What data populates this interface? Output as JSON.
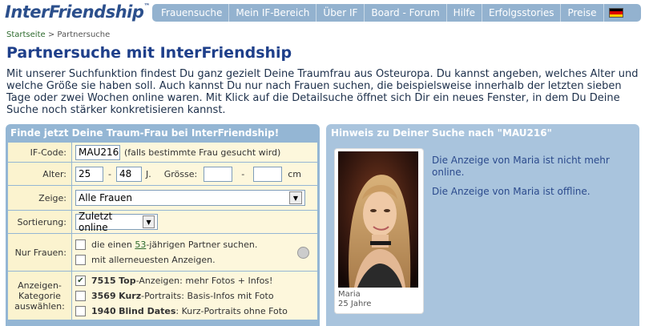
{
  "header": {
    "logo_text": "InterFriendship",
    "logo_mark": "™",
    "nav": [
      "Frauensuche",
      "Mein IF-Bereich",
      "Über IF",
      "Board - Forum",
      "Hilfe",
      "Erfolgsstories",
      "Preise"
    ],
    "language_flag": "german-flag-icon"
  },
  "breadcrumb": {
    "home": "Startseite",
    "separator": " > ",
    "current": "Partnersuche"
  },
  "page_title": "Partnersuche mit InterFriendship",
  "intro": "Mit unserer Suchfunktion findest Du ganz gezielt Deine Traumfrau aus Osteuropa. Du kannst angeben, welches Alter und welche Größe sie haben soll. Auch kannst Du nur nach Frauen suchen, die beispielsweise innerhalb der letzten sieben Tage oder zwei Wochen online waren. Mit Klick auf die Detailsuche öffnet sich Dir ein neues Fenster, in dem Du Deine Suche noch stärker konkretisieren kannst.",
  "search": {
    "title": "Finde jetzt Deine Traum-Frau bei InterFriendship!",
    "if_code_label": "IF-Code:",
    "if_code_value": "MAU216",
    "if_code_hint": "(falls bestimmte Frau gesucht wird)",
    "age_label": "Alter:",
    "age_from": "25",
    "age_sep": "-",
    "age_to": "48",
    "age_unit": "J.",
    "size_label": "Grösse:",
    "size_from": "",
    "size_sep": "-",
    "size_to": "",
    "size_unit": "cm",
    "show_label": "Zeige:",
    "show_value": "Alle Frauen",
    "sort_label": "Sortierung:",
    "sort_value": "Zuletzt online",
    "only_women_label": "Nur Frauen:",
    "only_option_1_pre": "die einen ",
    "only_option_1_link": "53",
    "only_option_1_post": "-jährigen Partner suchen.",
    "only_option_2": "mit allerneuesten Anzeigen.",
    "category_label": "Anzeigen-Kategorie auswählen:",
    "categories": [
      {
        "count": "7515",
        "name": "Top",
        "desc": "-Anzeigen: mehr Fotos + Infos!",
        "checked": true
      },
      {
        "count": "3569",
        "name": "Kurz",
        "desc": "-Portraits: Basis-Infos mit Foto",
        "checked": false
      },
      {
        "count": "1940",
        "name": "Blind Dates",
        "desc": ": Kurz-Portraits ohne Foto",
        "checked": false
      }
    ]
  },
  "hint": {
    "title": "Hinweis zu Deiner Suche nach \"MAU216\"",
    "photo_name": "Maria",
    "photo_age": "25 Jahre",
    "message_1": "Die Anzeige von Maria ist nicht mehr online.",
    "message_2": "Die Anzeige von Maria ist offline."
  },
  "colors": {
    "nav_bg": "#93b2cf",
    "panel_bg": "#94b6d4",
    "title_blue": "#1e3f8a",
    "form_bg": "#fdf7dc"
  }
}
